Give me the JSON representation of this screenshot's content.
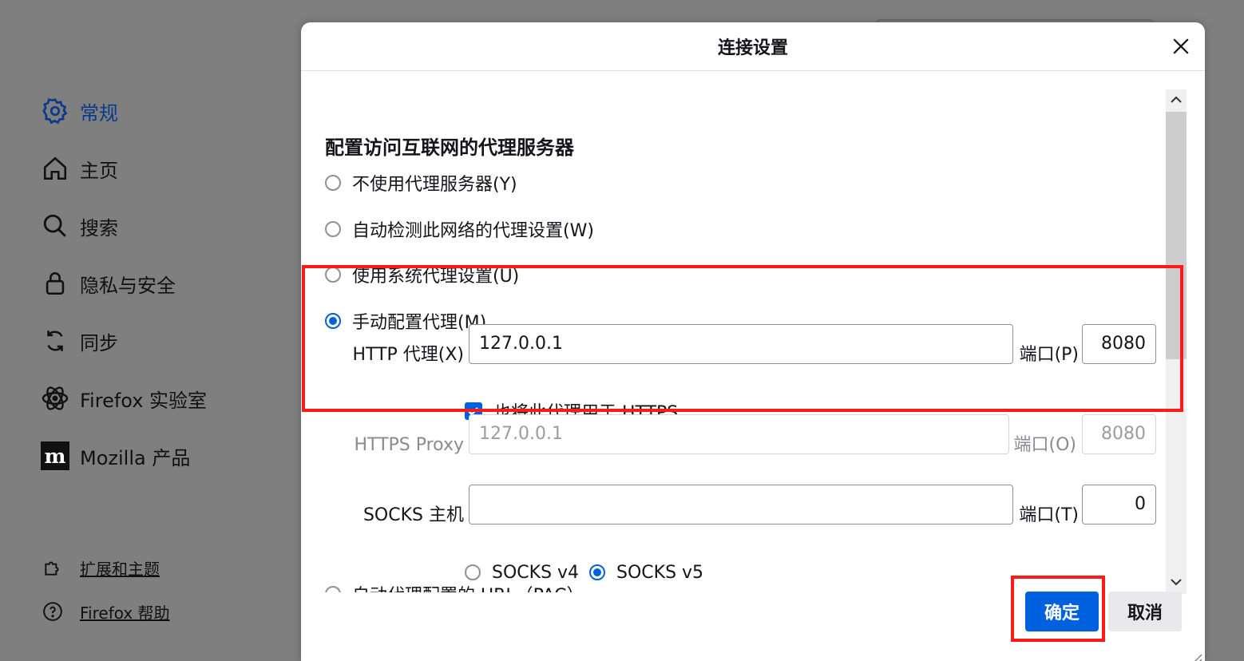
{
  "sidebar": {
    "items": [
      {
        "label": "常规",
        "icon": "gear-icon"
      },
      {
        "label": "主页",
        "icon": "home-icon"
      },
      {
        "label": "搜索",
        "icon": "search-icon"
      },
      {
        "label": "隐私与安全",
        "icon": "lock-icon"
      },
      {
        "label": "同步",
        "icon": "sync-icon"
      },
      {
        "label": "Firefox 实验室",
        "icon": "labs-icon"
      },
      {
        "label": "Mozilla 产品",
        "icon": "mozilla-icon"
      }
    ],
    "footer": [
      {
        "label": "扩展和主题",
        "icon": "puzzle-icon"
      },
      {
        "label": "Firefox 帮助",
        "icon": "help-icon"
      }
    ]
  },
  "dialog": {
    "title": "连接设置",
    "section_title": "配置访问互联网的代理服务器",
    "radios": {
      "no_proxy": "不使用代理服务器(Y)",
      "auto_detect": "自动检测此网络的代理设置(W)",
      "system": "使用系统代理设置(U)",
      "manual": "手动配置代理(M)",
      "pac_partial": "自动代理配置的 URL（PAC）"
    },
    "selected_mode": "manual",
    "http_proxy": {
      "label": "HTTP 代理(X)",
      "value": "127.0.0.1",
      "port_label": "端口(P)",
      "port": "8080"
    },
    "use_for_https": {
      "label": "也将此代理用于 HTTPS",
      "checked": true
    },
    "https_proxy": {
      "label": "HTTPS Proxy",
      "value": "127.0.0.1",
      "port_label": "端口(O)",
      "port": "8080"
    },
    "socks": {
      "label": "SOCKS 主机",
      "value": "",
      "port_label": "端口(T)",
      "port": "0",
      "v4": "SOCKS v4",
      "v5": "SOCKS v5",
      "version": "v5"
    },
    "buttons": {
      "ok": "确定",
      "cancel": "取消"
    }
  },
  "colors": {
    "accent": "#0061e0",
    "highlight": "#ff1a1a",
    "overlay": "#7f7f7f"
  }
}
